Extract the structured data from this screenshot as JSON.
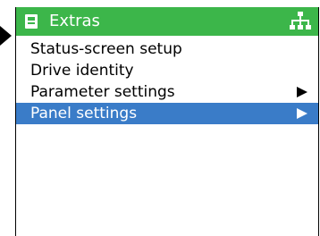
{
  "colors": {
    "titlebar": "#3cb64a",
    "selected": "#3a7cc8",
    "text": "#000000",
    "selected_text": "#ffffff"
  },
  "header": {
    "title": "Extras",
    "left_icon": "device-icon",
    "right_icon": "network-icon"
  },
  "menu": {
    "items": [
      {
        "label": "Status-screen setup",
        "has_submenu": false,
        "selected": false
      },
      {
        "label": "Drive identity",
        "has_submenu": false,
        "selected": false
      },
      {
        "label": "Parameter settings",
        "has_submenu": true,
        "selected": false
      },
      {
        "label": "Panel settings",
        "has_submenu": true,
        "selected": true
      }
    ]
  }
}
